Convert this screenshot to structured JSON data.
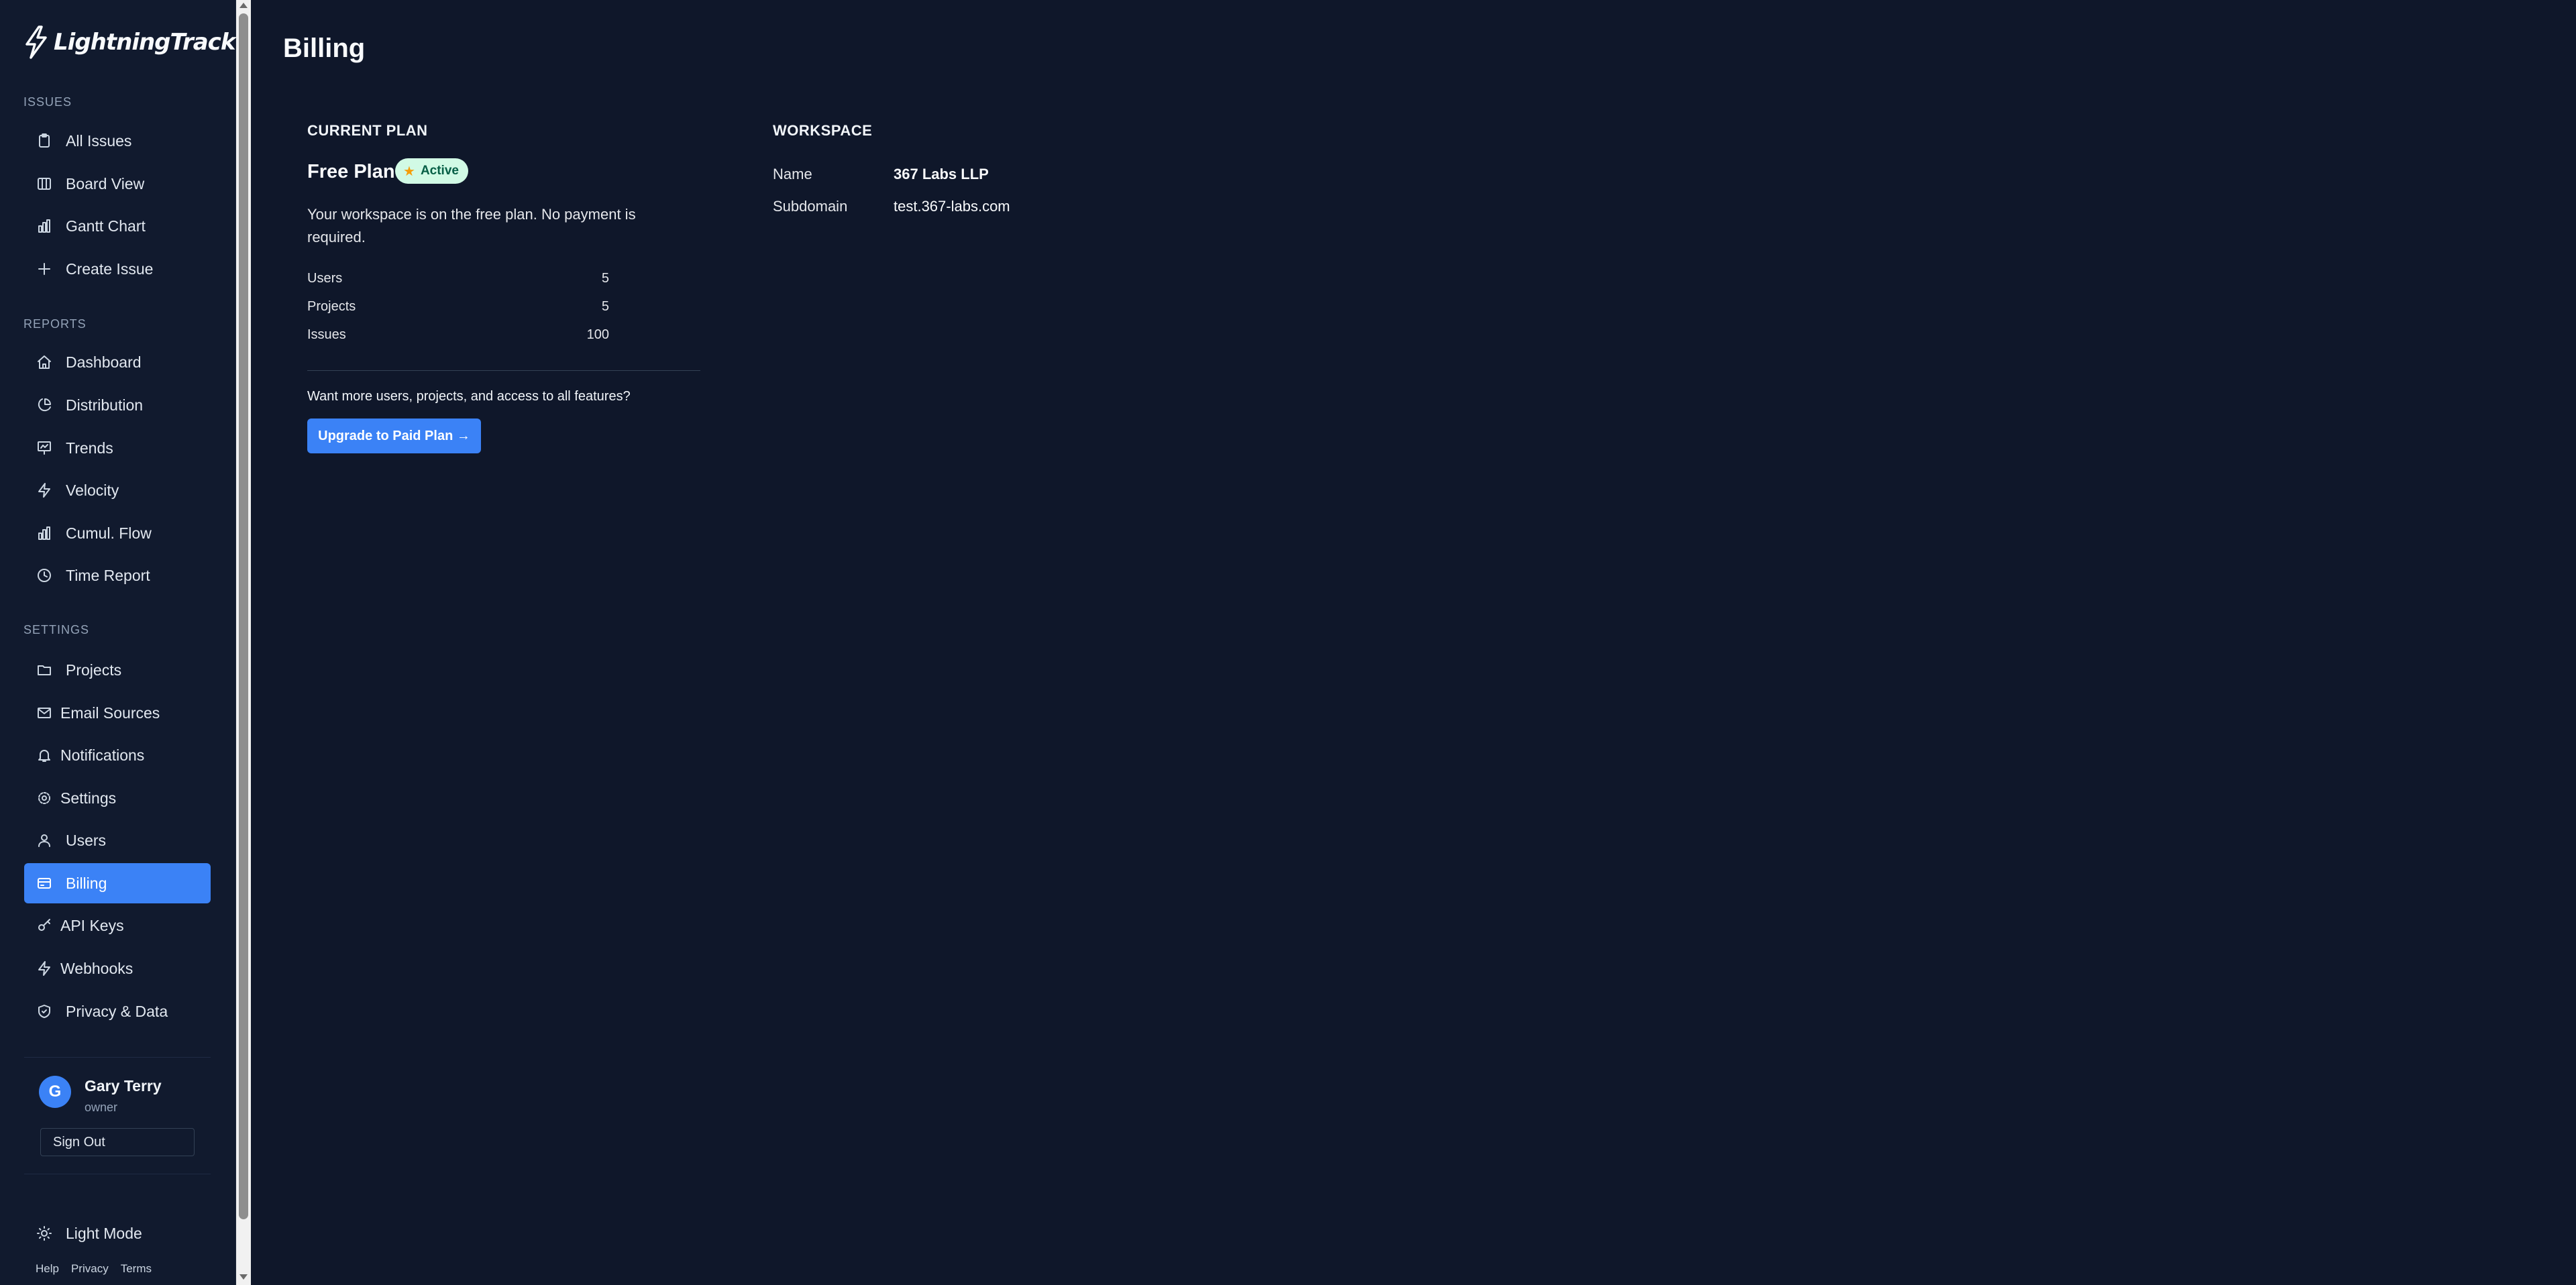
{
  "app": {
    "name": "LightningTrack"
  },
  "sidebar": {
    "issues_label": "Issues",
    "issues": [
      {
        "label": "All Issues",
        "icon": "clipboard-icon"
      },
      {
        "label": "Board View",
        "icon": "columns-icon"
      },
      {
        "label": "Gantt Chart",
        "icon": "bar-chart-icon"
      },
      {
        "label": "Create Issue",
        "icon": "plus-icon"
      }
    ],
    "reports_label": "Reports",
    "reports": [
      {
        "label": "Dashboard",
        "icon": "home-icon"
      },
      {
        "label": "Distribution",
        "icon": "pie-chart-icon"
      },
      {
        "label": "Trends",
        "icon": "presentation-icon"
      },
      {
        "label": "Velocity",
        "icon": "lightning-icon"
      },
      {
        "label": "Cumul. Flow",
        "icon": "bar-chart-icon"
      },
      {
        "label": "Time Report",
        "icon": "clock-icon"
      }
    ],
    "settings_label": "Settings",
    "settings": [
      {
        "label": "Projects",
        "icon": "folder-icon"
      },
      {
        "label": "Email Sources",
        "icon": "mail-icon"
      },
      {
        "label": "Notifications",
        "icon": "bell-icon"
      },
      {
        "label": "Settings",
        "icon": "gear-icon"
      },
      {
        "label": "Users",
        "icon": "user-icon"
      },
      {
        "label": "Billing",
        "icon": "credit-card-icon",
        "active": true
      },
      {
        "label": "API Keys",
        "icon": "key-icon"
      },
      {
        "label": "Webhooks",
        "icon": "lightning-icon"
      },
      {
        "label": "Privacy & Data",
        "icon": "shield-icon"
      }
    ],
    "user": {
      "initial": "G",
      "name": "Gary Terry",
      "role": "owner"
    },
    "sign_out": "Sign Out",
    "theme_toggle": "Light Mode",
    "footer": {
      "help": "Help",
      "privacy": "Privacy",
      "terms": "Terms"
    }
  },
  "main": {
    "title": "Billing",
    "current_plan": {
      "heading": "Current Plan",
      "plan_name": "Free Plan",
      "badge": "Active",
      "description": "Your workspace is on the free plan. No payment is required.",
      "limits": [
        {
          "label": "Users",
          "value": "5"
        },
        {
          "label": "Projects",
          "value": "5"
        },
        {
          "label": "Issues",
          "value": "100"
        }
      ],
      "upsell": "Want more users, projects, and access to all features?",
      "upgrade_button": "Upgrade to Paid Plan →"
    },
    "workspace": {
      "heading": "Workspace",
      "name_label": "Name",
      "name_value": "367 Labs LLP",
      "subdomain_label": "Subdomain",
      "subdomain_value": "test.367-labs.com"
    }
  },
  "colors": {
    "background": "#0f172a",
    "sidebar": "#111a2e",
    "accent": "#3b82f6",
    "badge_bg": "#d1fae5",
    "badge_text": "#065f46"
  }
}
